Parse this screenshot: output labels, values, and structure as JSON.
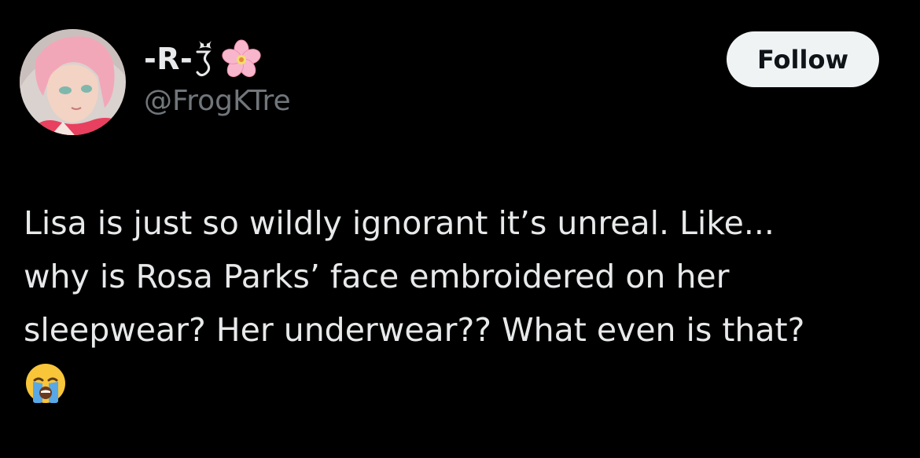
{
  "post": {
    "author": {
      "display_name": "-R-",
      "handle": "@FrogKTre",
      "avatar_icon": "anime-avatar-pink-hair",
      "name_decorations": [
        "bow-glyph",
        "cherry-blossom-icon"
      ]
    },
    "follow_label": "Follow",
    "text_lines": [
      "Lisa is just so wildly ignorant it’s unreal. Like...",
      "why is Rosa Parks’ face embroidered on her",
      "sleepwear? Her underwear?? What even is that?"
    ],
    "trailing_emoji": "crying-face-icon"
  },
  "colors": {
    "background": "#000000",
    "primary_text": "#e7e9ea",
    "secondary_text": "#71767b",
    "follow_bg": "#eff3f4",
    "follow_text": "#0f1419"
  }
}
